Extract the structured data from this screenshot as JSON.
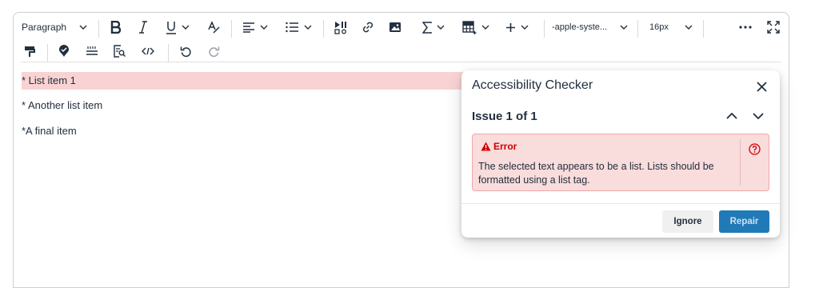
{
  "toolbar": {
    "block_format": "Paragraph",
    "font_family": "-apple-syste...",
    "font_size": "16px"
  },
  "content": {
    "lines": [
      "* List item 1",
      "* Another list item",
      "*A final item"
    ]
  },
  "dialog": {
    "title": "Accessibility Checker",
    "issue_label": "Issue 1 of 1",
    "error_title": "Error",
    "error_text": "The selected text appears to be a list. Lists should be formatted using a list tag.",
    "ignore_label": "Ignore",
    "repair_label": "Repair"
  },
  "colors": {
    "highlight": "#f9d3d3",
    "error_background": "#f9dcdc",
    "error_text": "#cc0000",
    "primary_button": "#207ab7"
  },
  "icons": [
    "bold-icon",
    "italic-icon",
    "underline-icon",
    "strikethrough-format-icon",
    "align-left-icon",
    "list-icon",
    "media-icon",
    "link-icon",
    "image-icon",
    "sigma-icon",
    "table-icon",
    "plus-icon",
    "more-icon",
    "fullscreen-icon",
    "format-painter-icon",
    "accessibility-icon",
    "horizontal-rule-icon",
    "preview-icon",
    "source-code-icon",
    "undo-icon",
    "redo-icon",
    "close-icon",
    "chevron-up-icon",
    "chevron-down-icon",
    "warning-icon",
    "help-icon"
  ]
}
